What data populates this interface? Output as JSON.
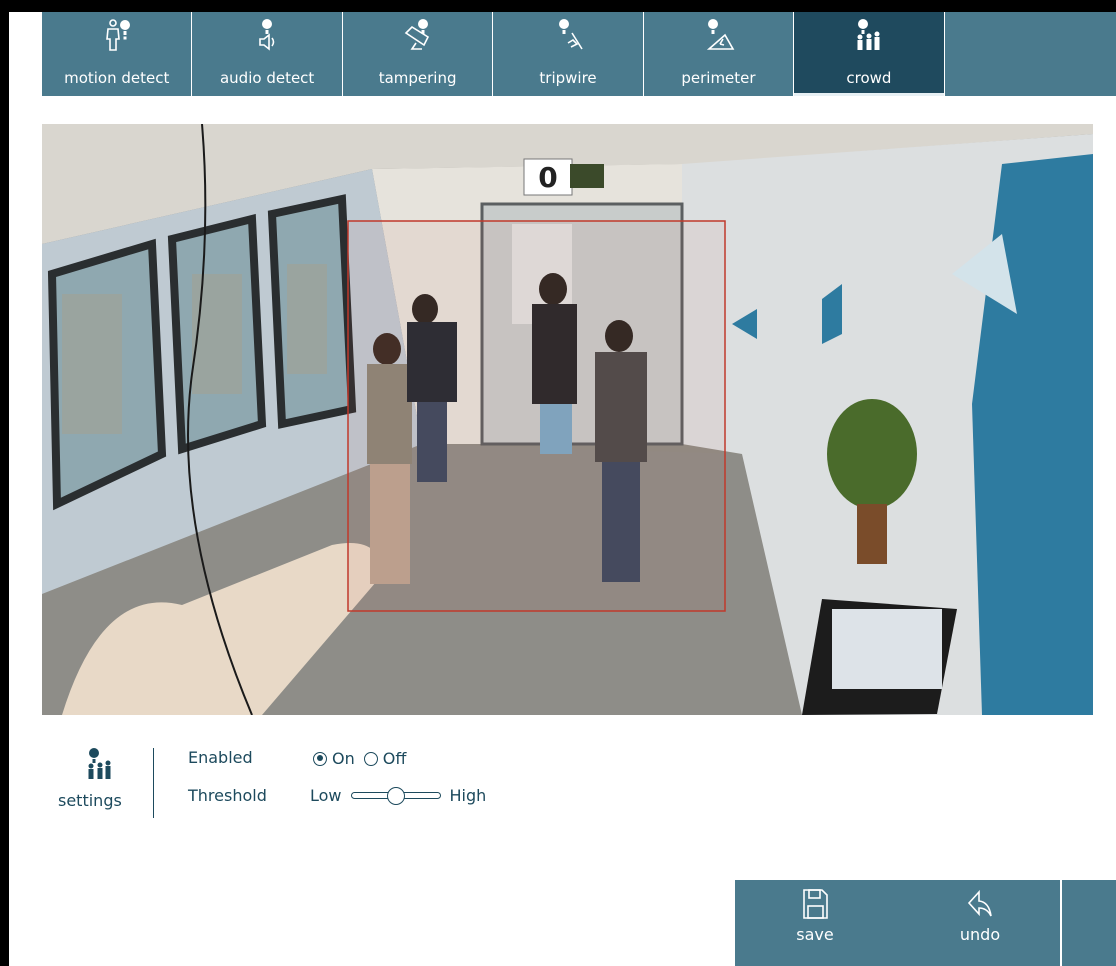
{
  "tabs": [
    {
      "label": "motion detect",
      "icon": "motion-detect-icon",
      "active": false
    },
    {
      "label": "audio detect",
      "icon": "audio-detect-icon",
      "active": false
    },
    {
      "label": "tampering",
      "icon": "tampering-icon",
      "active": false
    },
    {
      "label": "tripwire",
      "icon": "tripwire-icon",
      "active": false
    },
    {
      "label": "perimeter",
      "icon": "perimeter-icon",
      "active": false
    },
    {
      "label": "crowd",
      "icon": "crowd-icon",
      "active": true
    }
  ],
  "video": {
    "counter": "0"
  },
  "settings": {
    "label": "settings",
    "enabled": {
      "label": "Enabled",
      "options": [
        "On",
        "Off"
      ],
      "selected": "On"
    },
    "threshold": {
      "label": "Threshold",
      "low_label": "Low",
      "high_label": "High",
      "value": 0.5
    }
  },
  "actions": {
    "save_label": "save",
    "undo_label": "undo"
  },
  "colors": {
    "tab_bg": "#4a7a8d",
    "tab_active_bg": "#1f4a5e",
    "text_primary": "#1d4a5d",
    "zone_outline": "#c0392b"
  }
}
